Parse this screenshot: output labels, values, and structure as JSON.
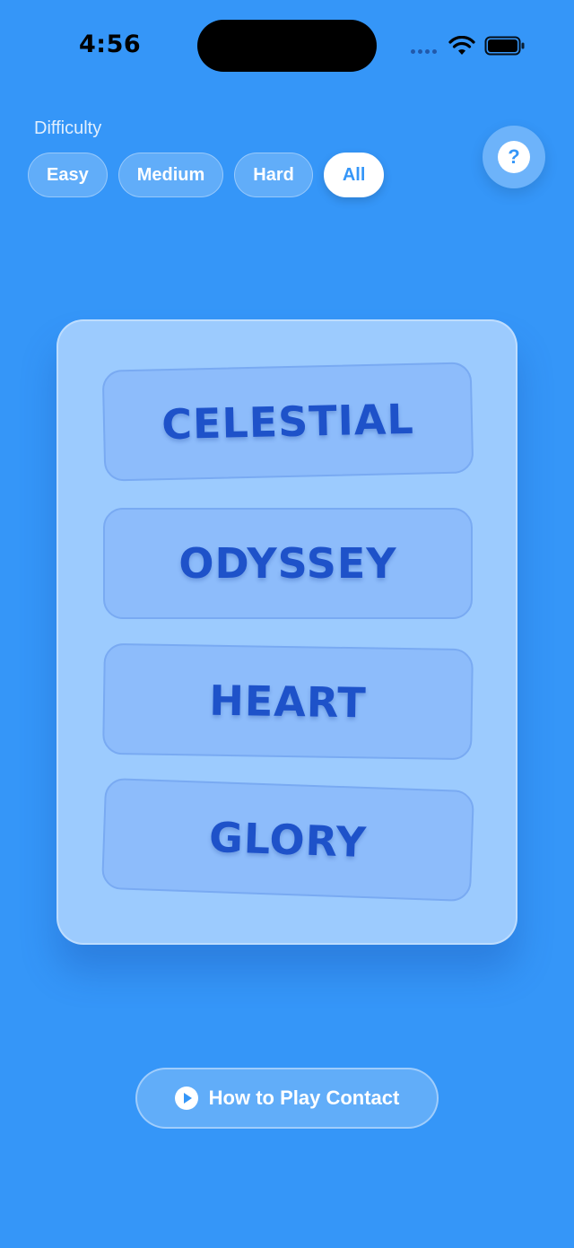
{
  "status_bar": {
    "time": "4:56"
  },
  "difficulty": {
    "label": "Difficulty",
    "options": [
      {
        "label": "Easy",
        "active": false
      },
      {
        "label": "Medium",
        "active": false
      },
      {
        "label": "Hard",
        "active": false
      },
      {
        "label": "All",
        "active": true
      }
    ]
  },
  "help": {
    "symbol": "?"
  },
  "card": {
    "words": [
      "CELESTIAL",
      "ODYSSEY",
      "HEART",
      "GLORY"
    ]
  },
  "how_to_play": {
    "label": "How to Play Contact",
    "icon": "play-icon"
  },
  "colors": {
    "background": "#3596F8",
    "card": "#9CCBFE",
    "tile": "#8DBCFB",
    "word_text": "#1E52C9"
  }
}
